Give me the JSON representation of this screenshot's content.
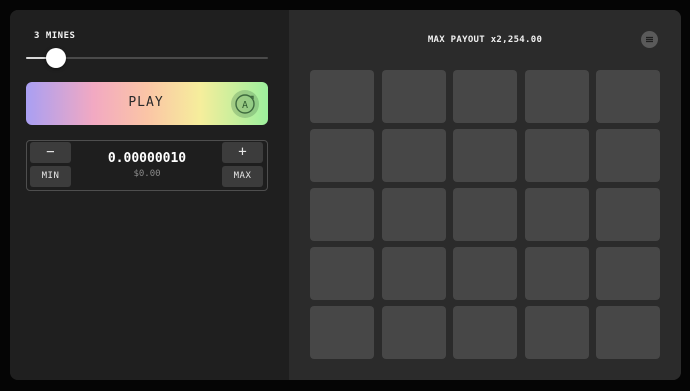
{
  "mines": {
    "label": "3 MINES",
    "count": 3
  },
  "play_button": {
    "label": "PLAY",
    "autoplay_icon": "autoplay-a-icon"
  },
  "bet": {
    "decrement_label": "−",
    "increment_label": "+",
    "min_label": "MIN",
    "max_label": "MAX",
    "amount": "0.00000010",
    "usd_value": "$0.00"
  },
  "board": {
    "max_payout": "MAX PAYOUT x2,254.00",
    "menu_icon": "menu-lines-icon",
    "rows": 5,
    "columns": 5
  },
  "colors": {
    "panel_left": "#1f1f1f",
    "panel_right": "#2b2b2b",
    "tile": "#474747",
    "play_gradient": [
      "#a99ff3",
      "#f2a9c2",
      "#fbc5a6",
      "#f6ee9c",
      "#9df09d"
    ]
  }
}
